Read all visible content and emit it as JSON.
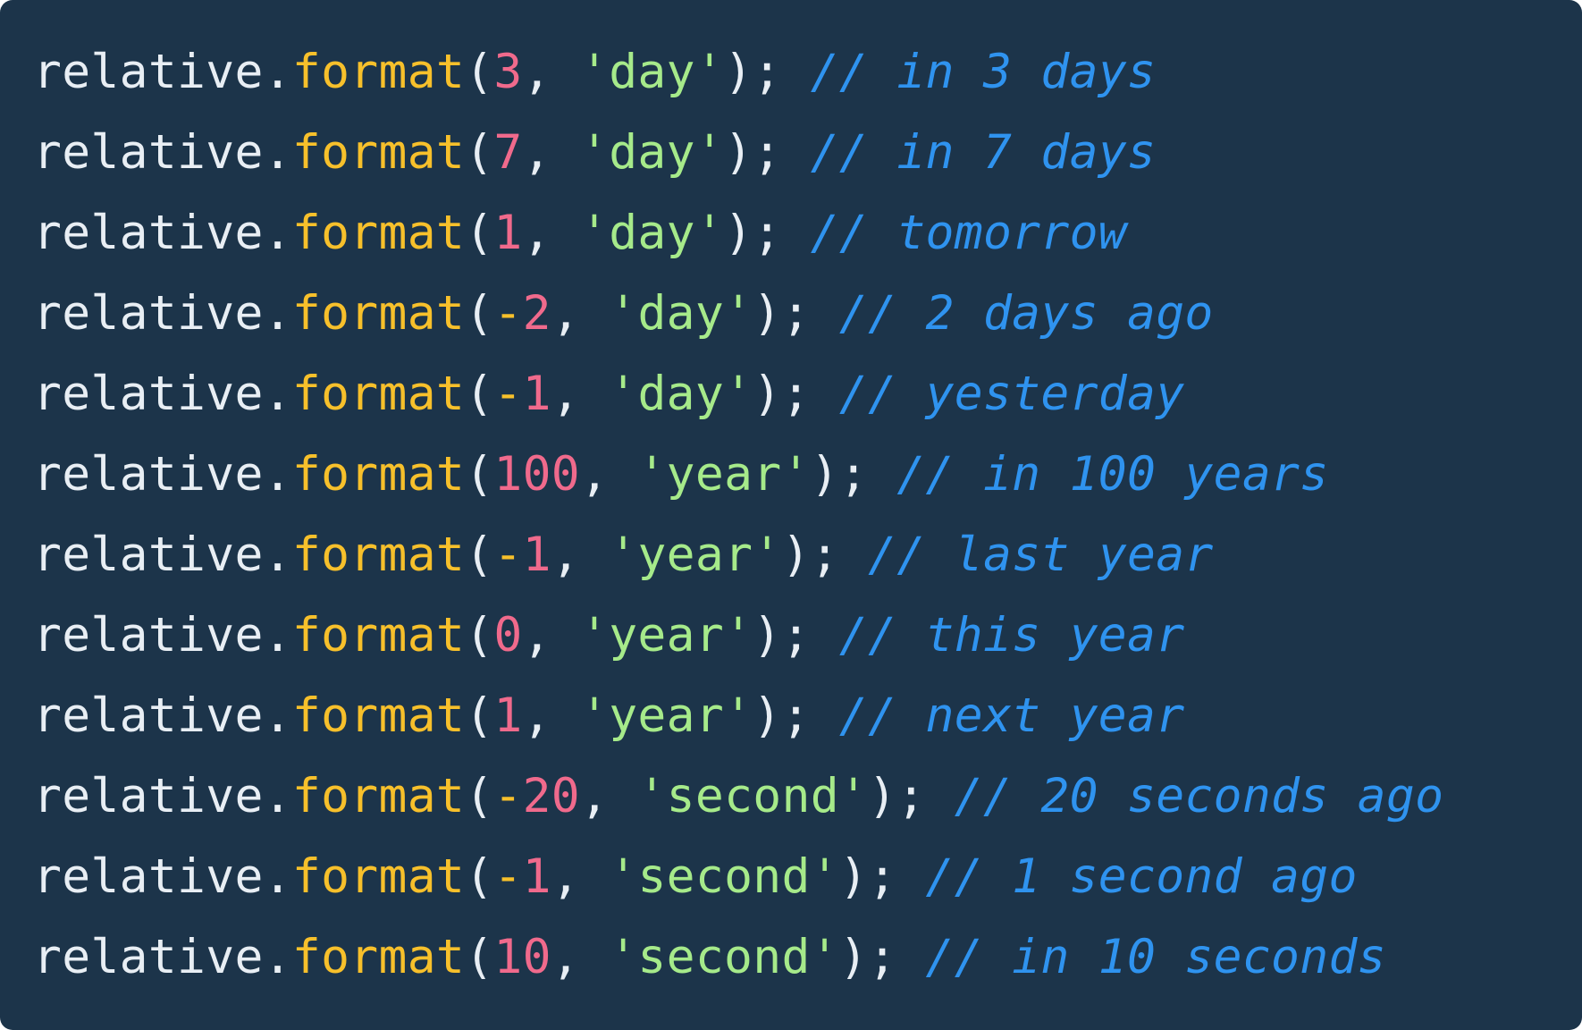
{
  "colors": {
    "background": "#1c344a",
    "identifier": "#e8eef4",
    "function": "#f7c02b",
    "number": "#f06a8c",
    "string": "#a6ea8a",
    "comment": "#2f93ef"
  },
  "code": {
    "lines": [
      {
        "obj": "relative",
        "dot": ".",
        "fn": "format",
        "open": "(",
        "sign": "",
        "num": "3",
        "comma": ", ",
        "str": "'day'",
        "close": ");",
        "comment": "// in 3 days"
      },
      {
        "obj": "relative",
        "dot": ".",
        "fn": "format",
        "open": "(",
        "sign": "",
        "num": "7",
        "comma": ", ",
        "str": "'day'",
        "close": ");",
        "comment": "// in 7 days"
      },
      {
        "obj": "relative",
        "dot": ".",
        "fn": "format",
        "open": "(",
        "sign": "",
        "num": "1",
        "comma": ", ",
        "str": "'day'",
        "close": ");",
        "comment": "// tomorrow"
      },
      {
        "obj": "relative",
        "dot": ".",
        "fn": "format",
        "open": "(",
        "sign": "-",
        "num": "2",
        "comma": ", ",
        "str": "'day'",
        "close": ");",
        "comment": "// 2 days ago"
      },
      {
        "obj": "relative",
        "dot": ".",
        "fn": "format",
        "open": "(",
        "sign": "-",
        "num": "1",
        "comma": ", ",
        "str": "'day'",
        "close": ");",
        "comment": "// yesterday"
      },
      {
        "obj": "relative",
        "dot": ".",
        "fn": "format",
        "open": "(",
        "sign": "",
        "num": "100",
        "comma": ", ",
        "str": "'year'",
        "close": ");",
        "comment": "// in 100 years"
      },
      {
        "obj": "relative",
        "dot": ".",
        "fn": "format",
        "open": "(",
        "sign": "-",
        "num": "1",
        "comma": ", ",
        "str": "'year'",
        "close": ");",
        "comment": "// last year"
      },
      {
        "obj": "relative",
        "dot": ".",
        "fn": "format",
        "open": "(",
        "sign": "",
        "num": "0",
        "comma": ", ",
        "str": "'year'",
        "close": ");",
        "comment": "// this year"
      },
      {
        "obj": "relative",
        "dot": ".",
        "fn": "format",
        "open": "(",
        "sign": "",
        "num": "1",
        "comma": ", ",
        "str": "'year'",
        "close": ");",
        "comment": "// next year"
      },
      {
        "obj": "relative",
        "dot": ".",
        "fn": "format",
        "open": "(",
        "sign": "-",
        "num": "20",
        "comma": ", ",
        "str": "'second'",
        "close": ");",
        "comment": "// 20 seconds ago"
      },
      {
        "obj": "relative",
        "dot": ".",
        "fn": "format",
        "open": "(",
        "sign": "-",
        "num": "1",
        "comma": ", ",
        "str": "'second'",
        "close": ");",
        "comment": "// 1 second ago"
      },
      {
        "obj": "relative",
        "dot": ".",
        "fn": "format",
        "open": "(",
        "sign": "",
        "num": "10",
        "comma": ", ",
        "str": "'second'",
        "close": ");",
        "comment": "// in 10 seconds"
      }
    ]
  }
}
